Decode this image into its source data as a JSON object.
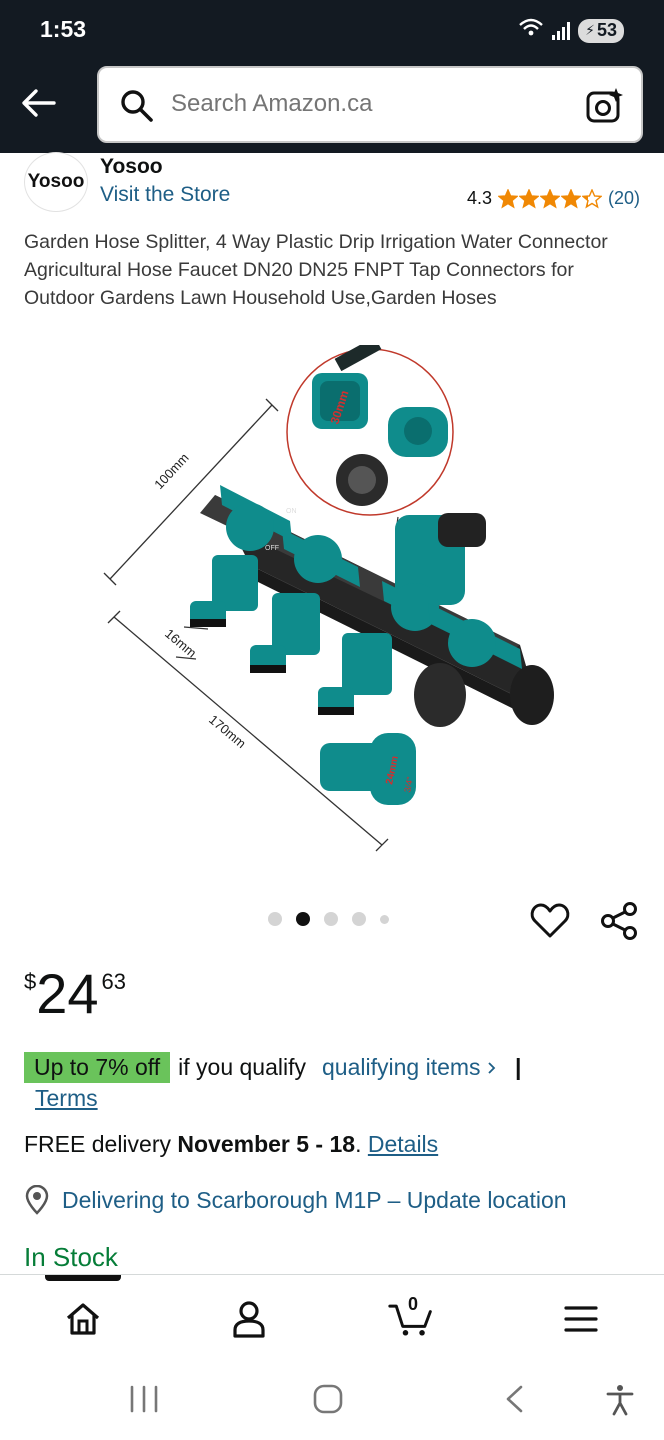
{
  "status_bar": {
    "time": "1:53",
    "wifi_label": "5",
    "battery": "53"
  },
  "header": {
    "search_placeholder": "Search Amazon.ca"
  },
  "brand": {
    "logo_text": "Yosoo",
    "name": "Yosoo",
    "visit_store": "Visit the Store"
  },
  "rating": {
    "value": "4.3",
    "count": "(20)",
    "stars_filled": 4.3
  },
  "product": {
    "title": "Garden Hose Splitter, 4 Way Plastic Drip Irrigation Water Connector Agricultural Hose Faucet DN20 DN25 FNPT Tap Connectors for Outdoor Gardens Lawn Household Use,Garden Hoses",
    "image_labels": {
      "dim_length": "100mm",
      "dim_width": "170mm",
      "dim_nozzle": "16mm",
      "dim_30": "30mm",
      "dim_24": "24mm",
      "dim_34": "3/4\"",
      "on": "ON",
      "off": "OFF"
    },
    "image_count": 5,
    "active_image": 2
  },
  "price": {
    "currency": "$",
    "whole": "24",
    "fraction": "63"
  },
  "deal": {
    "badge": "Up to 7% off",
    "text": "if you qualify",
    "link": "qualifying items",
    "separator": "|",
    "terms": "Terms"
  },
  "delivery": {
    "prefix": "FREE delivery ",
    "dates": "November 5 - 18",
    "suffix": ". ",
    "details": "Details"
  },
  "location": {
    "text": "Delivering to Scarborough M1P – Update location"
  },
  "stock": {
    "text": "In Stock"
  },
  "bottom_nav": {
    "cart_count": "0",
    "items": [
      "home-icon",
      "account-icon",
      "cart-icon",
      "menu-icon"
    ]
  },
  "colors": {
    "header_bg": "#131a22",
    "link": "#1e5e86",
    "deal_green": "#6ac35b",
    "stock_green": "#067d38",
    "star": "#f08804",
    "teal": "#0f8c8c"
  }
}
